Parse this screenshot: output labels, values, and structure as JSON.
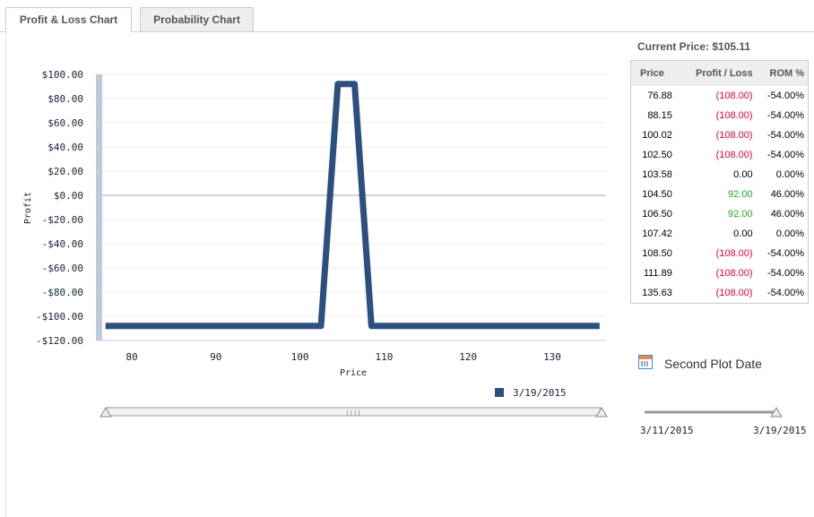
{
  "tabs": {
    "pl": "Profit & Loss Chart",
    "prob": "Probability Chart"
  },
  "current_price": "Current Price: $105.11",
  "table": {
    "headers": [
      "Price",
      "Profit / Loss",
      "ROM %"
    ],
    "rows": [
      [
        "76.88",
        "(108.00)",
        "-54.00%",
        "neg"
      ],
      [
        "88.15",
        "(108.00)",
        "-54.00%",
        "neg"
      ],
      [
        "100.02",
        "(108.00)",
        "-54.00%",
        "neg"
      ],
      [
        "102.50",
        "(108.00)",
        "-54.00%",
        "neg"
      ],
      [
        "103.58",
        "0.00",
        "0.00%",
        ""
      ],
      [
        "104.50",
        "92.00",
        "46.00%",
        "pos"
      ],
      [
        "106.50",
        "92.00",
        "46.00%",
        "pos"
      ],
      [
        "107.42",
        "0.00",
        "0.00%",
        ""
      ],
      [
        "108.50",
        "(108.00)",
        "-54.00%",
        "neg"
      ],
      [
        "111.89",
        "(108.00)",
        "-54.00%",
        "neg"
      ],
      [
        "135.63",
        "(108.00)",
        "-54.00%",
        "neg"
      ]
    ]
  },
  "second_plot_date": "Second Plot Date",
  "date_slider": {
    "start": "3/11/2015",
    "end": "3/19/2015",
    "value_fraction": 1.0
  },
  "colors": {
    "series": "#2b4f80",
    "loss": "#e8003a",
    "gain": "#22aa22"
  },
  "chart_data": {
    "type": "line",
    "xlabel": "Price",
    "ylabel": "Profit",
    "xlim": [
      76.88,
      135.63
    ],
    "ylim": [
      -120,
      100
    ],
    "xticks": [
      80,
      90,
      100,
      110,
      120,
      130
    ],
    "yticks": [
      100,
      80,
      60,
      40,
      20,
      0,
      -20,
      -40,
      -60,
      -80,
      -100,
      -120
    ],
    "ytick_labels": [
      "$100.00",
      "$80.00",
      "$60.00",
      "$40.00",
      "$20.00",
      "$0.00",
      "-$20.00",
      "-$40.00",
      "-$60.00",
      "-$80.00",
      "-$100.00",
      "-$120.00"
    ],
    "series": [
      {
        "name": "3/19/2015",
        "x": [
          76.88,
          102.5,
          104.5,
          106.5,
          108.5,
          135.63
        ],
        "y": [
          -108,
          -108,
          92,
          92,
          -108,
          -108
        ]
      }
    ]
  }
}
